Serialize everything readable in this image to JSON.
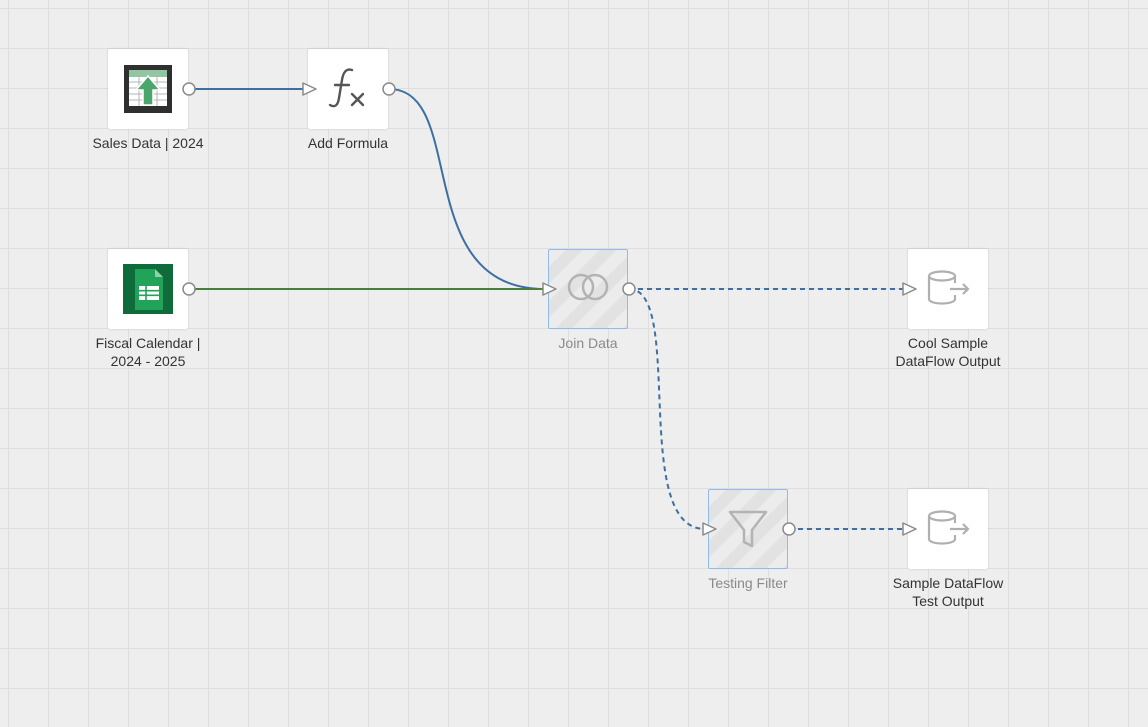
{
  "nodes": {
    "sales_data": {
      "label": "Sales Data | 2024",
      "icon": "spreadsheet-upload-icon"
    },
    "add_formula": {
      "label": "Add Formula",
      "icon": "formula-fx-icon"
    },
    "fiscal_calendar": {
      "label_line1": "Fiscal Calendar |",
      "label_line2": "2024 - 2025",
      "icon": "google-sheets-icon"
    },
    "join_data": {
      "label": "Join Data",
      "icon": "join-circles-icon",
      "state": "disabled"
    },
    "cool_output": {
      "label_line1": "Cool Sample",
      "label_line2": "DataFlow Output",
      "icon": "database-output-icon"
    },
    "testing_filter": {
      "label": "Testing Filter",
      "icon": "filter-funnel-icon",
      "state": "disabled"
    },
    "test_output": {
      "label_line1": "Sample DataFlow",
      "label_line2": "Test Output",
      "icon": "database-output-icon"
    }
  },
  "connections": [
    {
      "from": "sales_data",
      "to": "add_formula",
      "style": "solid",
      "color": "#3d6fa5"
    },
    {
      "from": "add_formula",
      "to": "join_data",
      "style": "solid",
      "color": "#3d6fa5"
    },
    {
      "from": "fiscal_calendar",
      "to": "join_data",
      "style": "solid",
      "color": "#4a7f3a"
    },
    {
      "from": "join_data",
      "to": "cool_output",
      "style": "dashed",
      "color": "#3d6fa5"
    },
    {
      "from": "join_data",
      "to": "testing_filter",
      "style": "dashed",
      "color": "#3d6fa5"
    },
    {
      "from": "testing_filter",
      "to": "test_output",
      "style": "dashed",
      "color": "#3d6fa5"
    }
  ],
  "colors": {
    "canvas": "#eeeeee",
    "grid": "#dedede",
    "wire_blue": "#3d6fa5",
    "wire_green": "#4a7f3a",
    "disabled_border": "#8fbcec",
    "sheets_green": "#1e7a45"
  }
}
